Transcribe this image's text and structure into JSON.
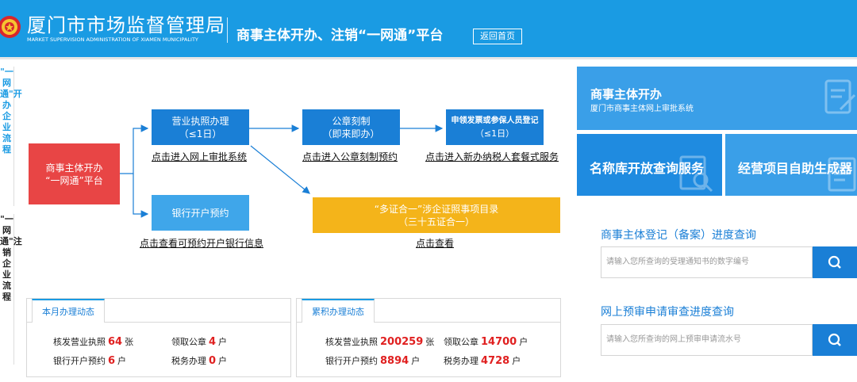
{
  "header": {
    "org_name": "厦门市市场监督管理局",
    "org_name_en": "MARKET SUPERVISION ADMINISTRATION OF XIAMEN MUNICIPALITY",
    "platform_title": "商事主体开办、注销“一网通”平台",
    "home_label": "返回首页"
  },
  "sidebar": {
    "open_flow": "\"一网通\"开办企业流程",
    "cancel_flow": "\"一网通\"注销企业流程"
  },
  "flow": {
    "start": {
      "line1": "商事主体开办",
      "line2": "“一网通”平台"
    },
    "license": {
      "line1": "营业执照办理",
      "line2": "（≤1日）",
      "link": "点击进入网上审批系统"
    },
    "seal": {
      "line1": "公章刻制",
      "line2": "（即来即办）",
      "link": "点击进入公章刻制预约"
    },
    "invoice": {
      "line1": "申领发票或参保人员登记",
      "line2": "（≤1日）",
      "link": "点击进入新办纳税人套餐式服务"
    },
    "bank": {
      "line1": "银行开户预约",
      "link": "点击查看可预约开户银行信息"
    },
    "certs": {
      "line1": "“多证合一”涉企证照事项目录",
      "line2": "（三十五证合一）",
      "link": "点击查看"
    }
  },
  "stats": {
    "month": {
      "tab": "本月办理动态",
      "license_label": "核发营业执照",
      "license_value": "64",
      "license_unit": "张",
      "seal_label": "领取公章",
      "seal_value": "4",
      "seal_unit": "户",
      "bank_label": "银行开户预约",
      "bank_value": "6",
      "bank_unit": "户",
      "tax_label": "税务办理",
      "tax_value": "0",
      "tax_unit": "户"
    },
    "total": {
      "tab": "累积办理动态",
      "license_label": "核发营业执照",
      "license_value": "200259",
      "license_unit": "张",
      "seal_label": "领取公章",
      "seal_value": "14700",
      "seal_unit": "户",
      "bank_label": "银行开户预约",
      "bank_value": "8894",
      "bank_unit": "户",
      "tax_label": "税务办理",
      "tax_value": "4728",
      "tax_unit": "户"
    }
  },
  "cards": {
    "open_title": "商事主体开办",
    "open_sub": "厦门市商事主体网上审批系统",
    "name_query": "名称库开放查询服务",
    "biz_gen": "经营项目自助生成器"
  },
  "queries": {
    "registration": {
      "title": "商事主体登记（备案）进度查询",
      "placeholder": "请输入您所查询的受理通知书的数字编号"
    },
    "name_check": {
      "title": "网上预审申请审查进度查询",
      "placeholder": "请输入您所查询的网上预审申请流水号"
    }
  },
  "colors": {
    "header": "#1a9be3",
    "start": "#e84545",
    "step": "#1a7fd6",
    "bank": "#3fa6ea",
    "certs": "#f4b41a",
    "highlight": "#e02020"
  }
}
